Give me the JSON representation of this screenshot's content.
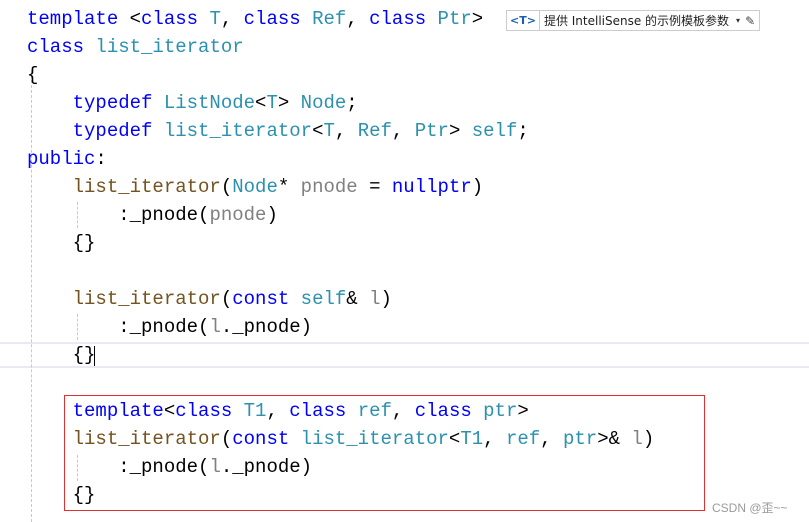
{
  "editor": {
    "intellisense_hint": {
      "tag": "<T>",
      "label": "提供 IntelliSense 的示例模板参数",
      "dropdown_icon": "▾",
      "edit_icon": "✎"
    },
    "lines": [
      {
        "tokens": [
          [
            "kw",
            "template "
          ],
          [
            "op",
            "<"
          ],
          [
            "kw",
            "class "
          ],
          [
            "ty",
            "T"
          ],
          [
            "op",
            ", "
          ],
          [
            "kw",
            "class "
          ],
          [
            "ty",
            "Ref"
          ],
          [
            "op",
            ", "
          ],
          [
            "kw",
            "class "
          ],
          [
            "ty",
            "Ptr"
          ],
          [
            "op",
            ">"
          ]
        ]
      },
      {
        "tokens": [
          [
            "kw",
            "class "
          ],
          [
            "ty",
            "list_iterator"
          ]
        ]
      },
      {
        "tokens": [
          [
            "op",
            "{"
          ]
        ]
      },
      {
        "tokens": [
          [
            "op",
            "    "
          ],
          [
            "kw",
            "typedef "
          ],
          [
            "ty",
            "ListNode"
          ],
          [
            "op",
            "<"
          ],
          [
            "ty",
            "T"
          ],
          [
            "op",
            "> "
          ],
          [
            "ty",
            "Node"
          ],
          [
            "op",
            ";"
          ]
        ]
      },
      {
        "tokens": [
          [
            "op",
            "    "
          ],
          [
            "kw",
            "typedef "
          ],
          [
            "ty",
            "list_iterator"
          ],
          [
            "op",
            "<"
          ],
          [
            "ty",
            "T"
          ],
          [
            "op",
            ", "
          ],
          [
            "ty",
            "Ref"
          ],
          [
            "op",
            ", "
          ],
          [
            "ty",
            "Ptr"
          ],
          [
            "op",
            "> "
          ],
          [
            "ty",
            "self"
          ],
          [
            "op",
            ";"
          ]
        ]
      },
      {
        "tokens": [
          [
            "kw",
            "public"
          ],
          [
            "op",
            ":"
          ]
        ]
      },
      {
        "tokens": [
          [
            "op",
            "    "
          ],
          [
            "fn",
            "list_iterator"
          ],
          [
            "op",
            "("
          ],
          [
            "ty",
            "Node"
          ],
          [
            "op",
            "* "
          ],
          [
            "pm",
            "pnode"
          ],
          [
            "op",
            " = "
          ],
          [
            "kw",
            "nullptr"
          ],
          [
            "op",
            ")"
          ]
        ]
      },
      {
        "tokens": [
          [
            "op",
            "        :_pnode("
          ],
          [
            "pm",
            "pnode"
          ],
          [
            "op",
            ")"
          ]
        ]
      },
      {
        "tokens": [
          [
            "op",
            "    {}"
          ]
        ]
      },
      {
        "tokens": []
      },
      {
        "tokens": [
          [
            "op",
            "    "
          ],
          [
            "fn",
            "list_iterator"
          ],
          [
            "op",
            "("
          ],
          [
            "kw",
            "const "
          ],
          [
            "ty",
            "self"
          ],
          [
            "op",
            "& "
          ],
          [
            "pm",
            "l"
          ],
          [
            "op",
            ")"
          ]
        ]
      },
      {
        "tokens": [
          [
            "op",
            "        :_pnode("
          ],
          [
            "pm",
            "l"
          ],
          [
            "op",
            "._pnode)"
          ]
        ]
      },
      {
        "tokens": [
          [
            "op",
            "    {}"
          ]
        ]
      },
      {
        "tokens": []
      },
      {
        "tokens": [
          [
            "op",
            "    "
          ],
          [
            "kw",
            "template"
          ],
          [
            "op",
            "<"
          ],
          [
            "kw",
            "class "
          ],
          [
            "ty",
            "T1"
          ],
          [
            "op",
            ", "
          ],
          [
            "kw",
            "class "
          ],
          [
            "ty",
            "ref"
          ],
          [
            "op",
            ", "
          ],
          [
            "kw",
            "class "
          ],
          [
            "ty",
            "ptr"
          ],
          [
            "op",
            ">"
          ]
        ]
      },
      {
        "tokens": [
          [
            "op",
            "    "
          ],
          [
            "fn",
            "list_iterator"
          ],
          [
            "op",
            "("
          ],
          [
            "kw",
            "const "
          ],
          [
            "ty",
            "list_iterator"
          ],
          [
            "op",
            "<"
          ],
          [
            "ty",
            "T1"
          ],
          [
            "op",
            ", "
          ],
          [
            "ty",
            "ref"
          ],
          [
            "op",
            ", "
          ],
          [
            "ty",
            "ptr"
          ],
          [
            "op",
            ">& "
          ],
          [
            "pm",
            "l"
          ],
          [
            "op",
            ")"
          ]
        ]
      },
      {
        "tokens": [
          [
            "op",
            "        :_pnode("
          ],
          [
            "pm",
            "l"
          ],
          [
            "op",
            "._pnode)"
          ]
        ]
      },
      {
        "tokens": [
          [
            "op",
            "    {}"
          ]
        ]
      }
    ],
    "current_line": 13
  },
  "watermark": "CSDN @歪~~",
  "colors": {
    "keyword": "#0000ff",
    "type": "#2b91af",
    "function": "#74531f",
    "parameter": "#808080",
    "highlight_box": "#e03030"
  }
}
